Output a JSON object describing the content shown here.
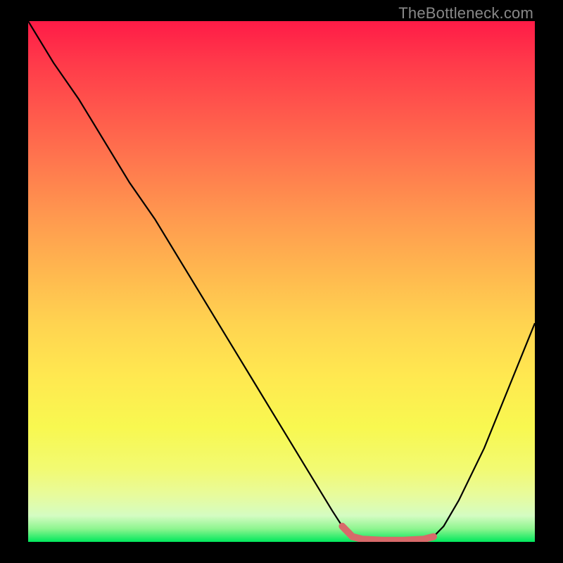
{
  "watermark": "TheBottleneck.com",
  "chart_data": {
    "type": "line",
    "title": "",
    "xlabel": "",
    "ylabel": "",
    "xlim": [
      0,
      100
    ],
    "ylim": [
      0,
      100
    ],
    "grid": false,
    "legend": false,
    "series": [
      {
        "name": "curve",
        "color": "#000000",
        "x": [
          0,
          5,
          10,
          15,
          20,
          25,
          30,
          35,
          40,
          45,
          50,
          55,
          60,
          62,
          64,
          66,
          70,
          74,
          78,
          80,
          82,
          85,
          90,
          95,
          100
        ],
        "y": [
          100,
          92,
          85,
          77,
          69,
          62,
          54,
          46,
          38,
          30,
          22,
          14,
          6,
          3,
          1,
          0.5,
          0.3,
          0.3,
          0.5,
          1,
          3,
          8,
          18,
          30,
          42
        ]
      },
      {
        "name": "highlight",
        "color": "#e06060",
        "x": [
          62,
          64,
          66,
          70,
          74,
          78,
          80
        ],
        "y": [
          3,
          1,
          0.5,
          0.3,
          0.3,
          0.5,
          1
        ]
      }
    ],
    "gradient_stops": [
      {
        "pos": 0,
        "color": "#ff1b47"
      },
      {
        "pos": 50,
        "color": "#ffd350"
      },
      {
        "pos": 80,
        "color": "#f8f850"
      },
      {
        "pos": 100,
        "color": "#00e85c"
      }
    ]
  }
}
